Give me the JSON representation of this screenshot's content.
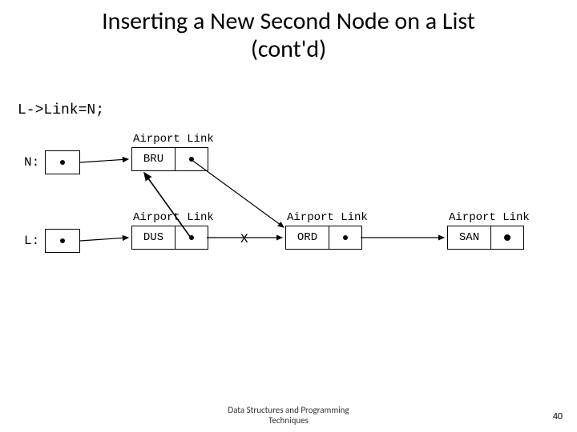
{
  "title": {
    "line1": "Inserting a New Second Node on a List",
    "line2": "(cont'd)"
  },
  "code": {
    "stmt": "L->Link=N;"
  },
  "fieldLabels": {
    "airport": "Airport",
    "link": "Link"
  },
  "pointers": {
    "n": {
      "label": "N:"
    },
    "l": {
      "label": "L:"
    }
  },
  "nodes": {
    "bru": {
      "airport": "BRU"
    },
    "dus": {
      "airport": "DUS"
    },
    "ord": {
      "airport": "ORD"
    },
    "san": {
      "airport": "SAN"
    }
  },
  "marks": {
    "x": "X"
  },
  "footer": {
    "line1": "Data Structures and Programming",
    "line2": "Techniques",
    "page": "40"
  }
}
